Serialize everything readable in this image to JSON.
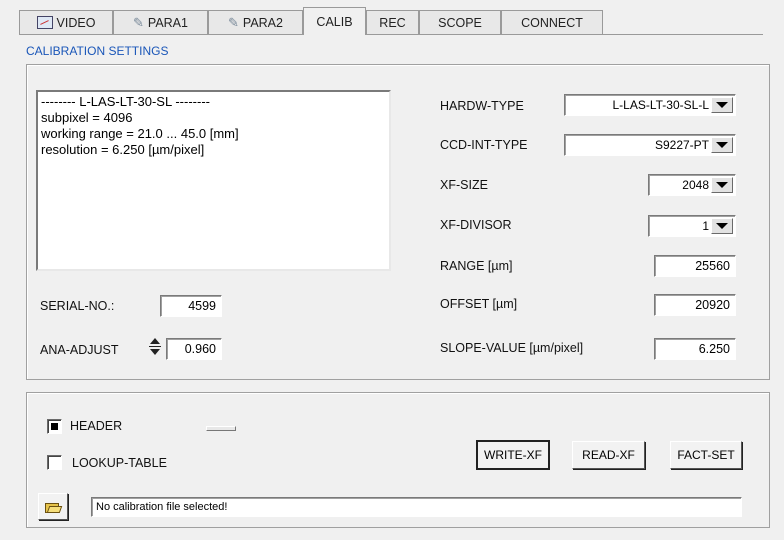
{
  "tabs": [
    {
      "label": "VIDEO",
      "icon": "video-icon"
    },
    {
      "label": "PARA1",
      "icon": "settings-icon"
    },
    {
      "label": "PARA2",
      "icon": "settings-icon"
    },
    {
      "label": "CALIB",
      "active": true
    },
    {
      "label": "REC"
    },
    {
      "label": "SCOPE"
    },
    {
      "label": "CONNECT"
    }
  ],
  "section_title": "CALIBRATION SETTINGS",
  "info_text": [
    "-------- L-LAS-LT-30-SL --------",
    "subpixel = 4096",
    "working range = 21.0  ...  45.0 [mm]",
    "resolution = 6.250 [µm/pixel]"
  ],
  "serial": {
    "label": "SERIAL-NO.:",
    "value": "4599"
  },
  "ana_adjust": {
    "label": "ANA-ADJUST",
    "value": "0.960"
  },
  "hardw_type": {
    "label": "HARDW-TYPE",
    "value": "L-LAS-LT-30-SL-L"
  },
  "ccd_int_type": {
    "label": "CCD-INT-TYPE",
    "value": "S9227-PT"
  },
  "xf_size": {
    "label": "XF-SIZE",
    "value": "2048"
  },
  "xf_divisor": {
    "label": "XF-DIVISOR",
    "value": "1"
  },
  "range": {
    "label": "RANGE  [µm]",
    "value": "25560"
  },
  "offset": {
    "label": "OFFSET  [µm]",
    "value": "20920"
  },
  "slope": {
    "label": "SLOPE-VALUE [µm/pixel]",
    "value": "6.250"
  },
  "header_check": {
    "label": "HEADER",
    "checked": true
  },
  "lookup_check": {
    "label": "LOOKUP-TABLE",
    "checked": false
  },
  "buttons": {
    "write": "WRITE-XF",
    "read": "READ-XF",
    "fact": "FACT-SET"
  },
  "status_text": "No calibration file selected!"
}
